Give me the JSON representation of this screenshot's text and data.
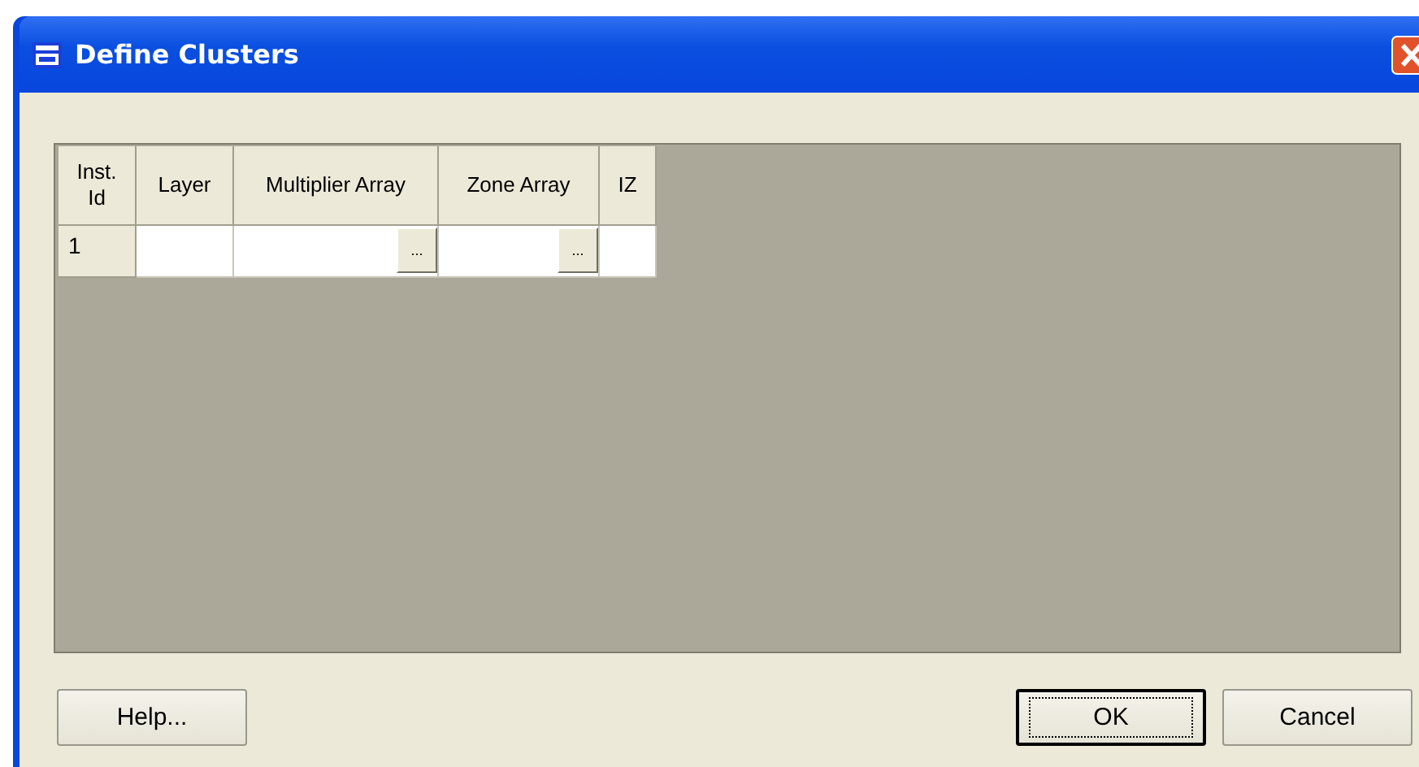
{
  "window": {
    "title": "Define Clusters"
  },
  "table": {
    "columns": [
      "Inst. Id",
      "Layer",
      "Multiplier Array",
      "Zone Array",
      "IZ"
    ],
    "rows": [
      {
        "id": "1",
        "cells": [
          {
            "kind": "text"
          },
          {
            "kind": "browse",
            "button": "..."
          },
          {
            "kind": "browse",
            "button": "..."
          },
          {
            "kind": "text"
          }
        ]
      }
    ]
  },
  "buttons": [
    {
      "label": "Help...",
      "default": false
    },
    {
      "label": "OK",
      "default": true
    },
    {
      "label": "Cancel",
      "default": false
    }
  ]
}
